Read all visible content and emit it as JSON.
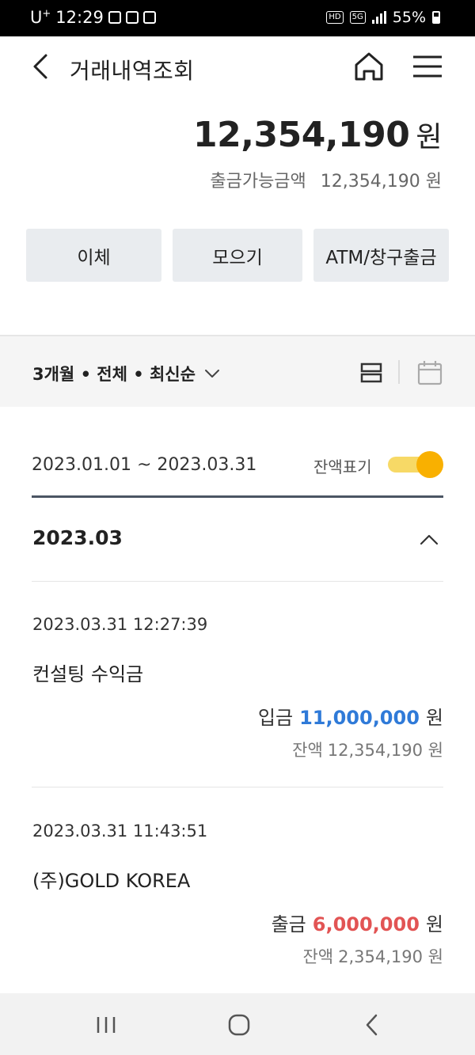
{
  "status_bar": {
    "carrier": "U",
    "carrier_sup": "+",
    "time": "12:29",
    "hd": "HD",
    "network": "5G",
    "battery": "55%"
  },
  "header": {
    "title": "거래내역조회",
    "back_icon": "chevron-left-icon",
    "home_icon": "home-icon",
    "menu_icon": "hamburger-menu-icon"
  },
  "balance": {
    "amount": "12,354,190",
    "unit": "원",
    "available_label": "출금가능금액",
    "available_amount": "12,354,190 원"
  },
  "actions": [
    {
      "label": "이체"
    },
    {
      "label": "모으기"
    },
    {
      "label": "ATM/창구출금"
    }
  ],
  "filter": {
    "label": "3개월 • 전체 • 최신순",
    "view_list_icon": "list-view-icon",
    "view_calendar_icon": "calendar-icon"
  },
  "period": {
    "range": "2023.01.01 ~ 2023.03.31",
    "toggle_label": "잔액표기",
    "toggle_on": true
  },
  "month": {
    "label": "2023.03"
  },
  "transactions": [
    {
      "datetime": "2023.03.31 12:27:39",
      "name": "컨설팅 수익금",
      "type_label": "입금",
      "amount": "11,000,000",
      "unit": "원",
      "balance_label": "잔액",
      "balance": "12,354,190 원",
      "color": "#2f7ad8"
    },
    {
      "datetime": "2023.03.31 11:43:51",
      "name": "(주)GOLD KOREA",
      "type_label": "출금",
      "amount": "6,000,000",
      "unit": "원",
      "balance_label": "잔액",
      "balance": "2,354,190 원",
      "color": "#e25454"
    }
  ],
  "colors": {
    "accent_yellow": "#f9b000",
    "deposit_blue": "#2f7ad8",
    "withdraw_red": "#e25454"
  }
}
